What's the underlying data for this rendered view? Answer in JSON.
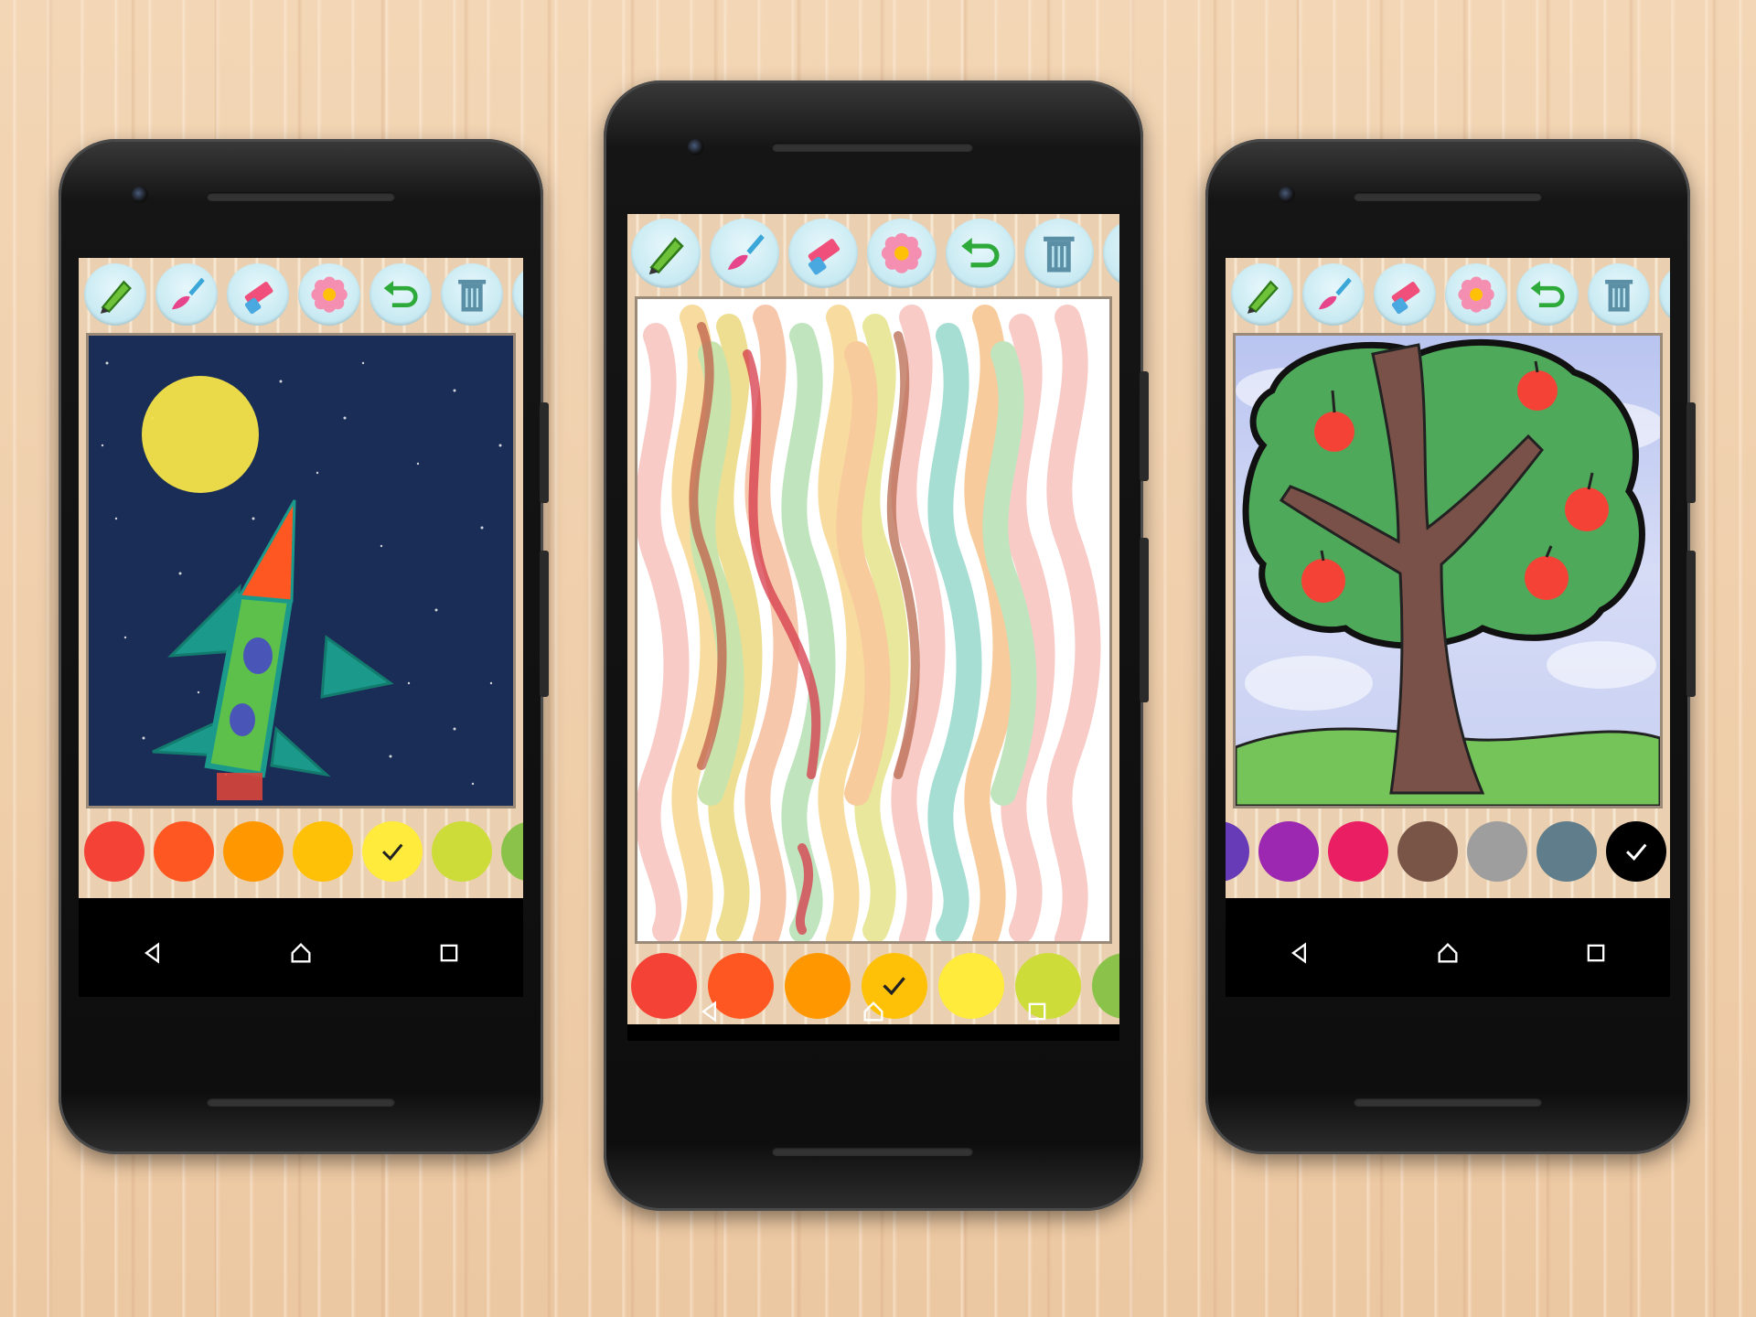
{
  "tools": [
    {
      "name": "pencil-tool",
      "icon": "pencil-icon"
    },
    {
      "name": "brush-tool",
      "icon": "brush-icon"
    },
    {
      "name": "eraser-tool",
      "icon": "eraser-icon"
    },
    {
      "name": "stamp-tool",
      "icon": "flower-icon"
    },
    {
      "name": "undo-tool",
      "icon": "undo-icon"
    },
    {
      "name": "delete-tool",
      "icon": "trash-icon"
    }
  ],
  "phones": [
    {
      "id": "left",
      "palette": [
        "#f44336",
        "#ff5722",
        "#ff9800",
        "#ffc107",
        "#ffeb3b",
        "#cddc39",
        "#8bc34a"
      ],
      "selected_color": "#ffeb3b",
      "drawing": "rocket-in-space"
    },
    {
      "id": "center",
      "palette": [
        "#f44336",
        "#ff5722",
        "#ff9800",
        "#ffc107",
        "#ffeb3b",
        "#cddc39",
        "#8bc34a"
      ],
      "selected_color": "#ffc107",
      "drawing": "wavy-lines"
    },
    {
      "id": "right",
      "palette": [
        "#673ab7",
        "#9c27b0",
        "#e91e63",
        "#795548",
        "#9e9e9e",
        "#607d8b",
        "#000000"
      ],
      "selected_color": "#000000",
      "drawing": "apple-tree"
    }
  ],
  "nav_icons": [
    "back-icon",
    "home-icon",
    "recents-icon"
  ]
}
